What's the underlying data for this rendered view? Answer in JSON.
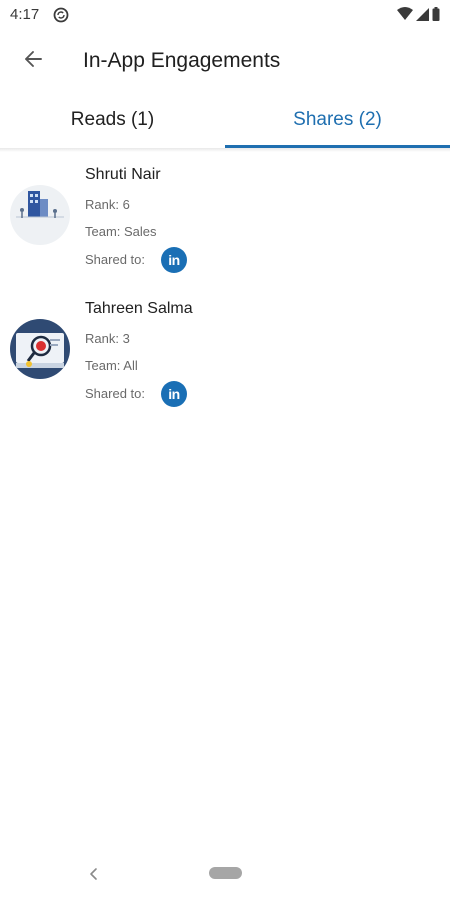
{
  "status_bar": {
    "time": "4:17",
    "icons": [
      "sync-icon",
      "wifi-icon",
      "signal-icon",
      "battery-icon"
    ]
  },
  "app_bar": {
    "title": "In-App Engagements",
    "back_icon": "arrow-back-icon"
  },
  "tabs": [
    {
      "label": "Reads (1)",
      "selected": false
    },
    {
      "label": "Shares (2)",
      "selected": true
    }
  ],
  "colors": {
    "accent": "#1f6fb0",
    "linkedin": "#1a6fb5",
    "meta_text": "#6a6a6a"
  },
  "shares": [
    {
      "name": "Shruti Nair",
      "rank": "Rank: 6",
      "team": "Team: Sales",
      "shared_to_label": "Shared to:",
      "shared_to_icon": "linkedin-icon",
      "linkedin_text": "in"
    },
    {
      "name": "Tahreen Salma",
      "rank": "Rank: 3",
      "team": "Team: All",
      "shared_to_label": "Shared to:",
      "shared_to_icon": "linkedin-icon",
      "linkedin_text": "in"
    }
  ],
  "nav_bar": {
    "icons": [
      "nav-back-icon",
      "home-pill-icon"
    ]
  }
}
